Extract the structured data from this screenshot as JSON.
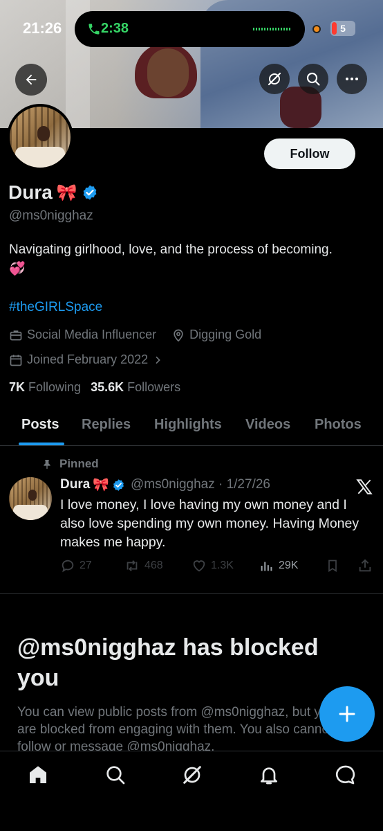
{
  "status_bar": {
    "time": "21:26",
    "call_timer": "2:38",
    "battery": "5",
    "colors": {
      "call": "#35d465",
      "dot": "#f28c1b",
      "battery_low": "#ff3b30"
    }
  },
  "header": {
    "back_icon": "arrow-left-icon",
    "buttons": [
      "grok-icon",
      "search-icon",
      "more-icon"
    ]
  },
  "profile": {
    "follow_label": "Follow",
    "display_name": "Dura",
    "name_emoji": "🎀",
    "handle": "@ms0nigghaz",
    "bio_line1": "Navigating girlhood, love, and the process of becoming.",
    "bio_emoji": "💞",
    "hashtag": "#theGIRLSpace",
    "profession": "Social Media Influencer",
    "location": "Digging Gold",
    "joined": "Joined February 2022",
    "following_count": "7K",
    "following_label": "Following",
    "followers_count": "35.6K",
    "followers_label": "Followers"
  },
  "tabs": [
    {
      "label": "Posts",
      "active": true
    },
    {
      "label": "Replies",
      "active": false
    },
    {
      "label": "Highlights",
      "active": false
    },
    {
      "label": "Videos",
      "active": false
    },
    {
      "label": "Photos",
      "active": false
    }
  ],
  "pinned_post": {
    "pinned_label": "Pinned",
    "author": "Dura",
    "author_emoji": "🎀",
    "handle_date": "@ms0nigghaz · 1/27/26",
    "text": "I love money, I love having my own money and I also love spending my own money. Having Money makes me happy.",
    "replies": "27",
    "reposts": "468",
    "likes": "1.3K",
    "views": "29K"
  },
  "blocked": {
    "title": "@ms0nigghaz has blocked you",
    "text": "You can view public posts from @ms0nigghaz, but you are blocked from engaging with them. You also cannot follow or message @ms0nigghaz."
  },
  "colors": {
    "accent": "#1d9bf0",
    "background": "#000000",
    "text_primary": "#e7e9ea",
    "text_secondary": "#71767b"
  },
  "bottom_nav": [
    "home-icon",
    "search-icon",
    "grok-icon",
    "notifications-icon",
    "messages-icon"
  ]
}
